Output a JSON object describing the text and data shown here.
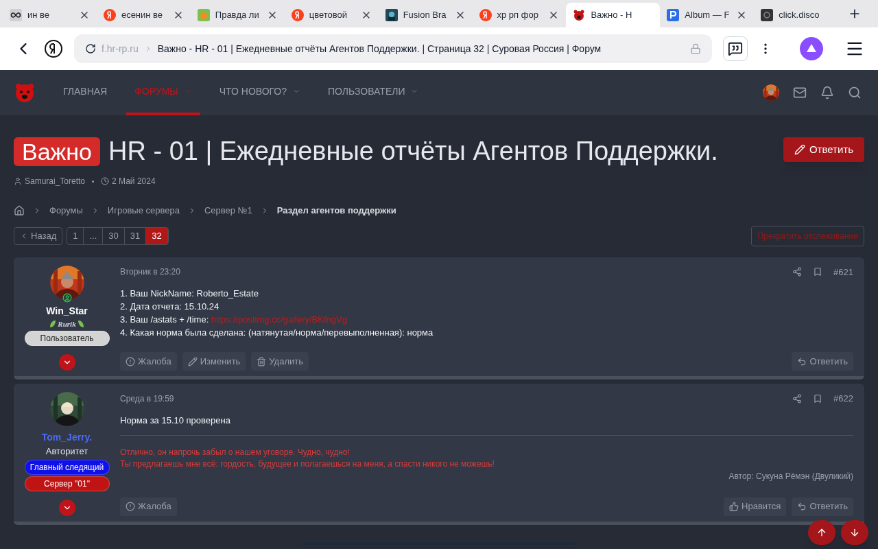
{
  "browser": {
    "tabs": [
      {
        "label": "ин ве",
        "kind": "infinity",
        "selected": false
      },
      {
        "label": "есенин ве",
        "kind": "yandex",
        "selected": false
      },
      {
        "label": "Правда ли",
        "kind": "green",
        "selected": false
      },
      {
        "label": "цветовой",
        "kind": "yandex",
        "selected": false
      },
      {
        "label": "Fusion Bra",
        "kind": "game",
        "selected": false
      },
      {
        "label": "хр рп фор",
        "kind": "yandex",
        "selected": false
      },
      {
        "label": "Важно - Н",
        "kind": "bear",
        "selected": true
      },
      {
        "label": "Album — F",
        "kind": "p",
        "selected": false
      },
      {
        "label": "click.disco",
        "kind": "dark",
        "selected": false
      }
    ],
    "address": {
      "domain": "f.hr-rp.ru",
      "title": "Важно - HR - 01 | Ежедневные отчёты Агентов Поддержки. | Страница 32 | Суровая Россия | Форум"
    }
  },
  "nav": [
    {
      "label": "ГЛАВНАЯ",
      "selected": false,
      "caret": false
    },
    {
      "label": "ФОРУМЫ",
      "selected": true,
      "caret": true
    },
    {
      "label": "ЧТО НОВОГО?",
      "selected": false,
      "caret": true
    },
    {
      "label": "ПОЛЬЗОВАТЕЛИ",
      "selected": false,
      "caret": true
    }
  ],
  "thread": {
    "prefix": "Важно",
    "title": "HR - 01 | Ежедневные отчёты Агентов Поддержки.",
    "author": "Samurai_Toretto",
    "date": "2 Май 2024",
    "reply_button": "Ответить"
  },
  "breadcrumbs": [
    "Форумы",
    "Игровые сервера",
    "Сервер №1",
    "Раздел агентов поддержки"
  ],
  "pagination": {
    "back": "Назад",
    "pages": [
      {
        "label": "1",
        "selected": false
      },
      {
        "label": "...",
        "selected": false
      },
      {
        "label": "30",
        "selected": false
      },
      {
        "label": "31",
        "selected": false
      },
      {
        "label": "32",
        "selected": true
      }
    ]
  },
  "unwatch": "Прекратить отслеживание",
  "posts": [
    {
      "user": {
        "name": "Win_Star",
        "color": "#ffffff",
        "online": true,
        "clan": "Rurik",
        "banners": [
          {
            "label": "Пользователь",
            "color": "#d4d4d4"
          }
        ]
      },
      "date": "Вторник в 23:20",
      "number": "#621",
      "body": [
        {
          "text": "1. Ваш NickName: Roberto_Estate"
        },
        {
          "text": "2. Дата отчета: 15.10.24"
        },
        {
          "text": "3. Ваш /astats + /time: ",
          "link": "https://postimg.cc/gallery/BKfngVg"
        },
        {
          "text": "4. Какая норма была сделана: (натянутая/норма/перевыполненная): норма"
        }
      ],
      "actions": [
        {
          "kind": "report",
          "label": "Жалоба"
        },
        {
          "kind": "edit",
          "label": "Изменить"
        },
        {
          "kind": "delete",
          "label": "Удалить"
        }
      ],
      "right_actions": [
        {
          "kind": "reply",
          "label": "Ответить"
        }
      ]
    },
    {
      "user": {
        "name": "Tom_Jerry.",
        "color": "#4a6cf0",
        "online": false,
        "title": "Авторитет",
        "banners": [
          {
            "label": "Главный следящий",
            "color": "#1010e8"
          },
          {
            "label": "Сервер \"01\"",
            "color": "#c01414"
          }
        ]
      },
      "date": "Среда в 19:59",
      "number": "#622",
      "body": [
        {
          "text": "Норма за 15.10 проверена"
        }
      ],
      "quote": [
        "Отлично, он напрочь забыл о нашем уговоре. Чудно, чудно!",
        "Ты предлагаешь мне всё: гордость, будущее и полагаешься на меня, а спасти никого не можешь!"
      ],
      "signature": "Автор: Сукуна Рёмэн (Двуликий)",
      "actions": [
        {
          "kind": "report",
          "label": "Жалоба"
        }
      ],
      "right_actions": [
        {
          "kind": "like",
          "label": "Нравится"
        },
        {
          "kind": "reply",
          "label": "Ответить"
        }
      ]
    }
  ]
}
